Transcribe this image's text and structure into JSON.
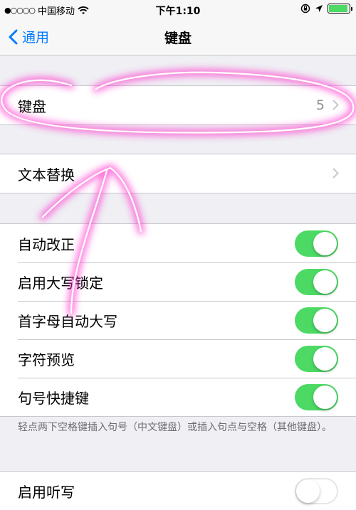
{
  "status_bar": {
    "signal": "●○○○○",
    "carrier": "中国移动",
    "time": "下午1:10"
  },
  "nav": {
    "back_label": "通用",
    "title": "键盘"
  },
  "keyboard_row": {
    "label": "键盘",
    "value": "5"
  },
  "text_replace_row": {
    "label": "文本替换"
  },
  "toggles": [
    {
      "label": "自动改正",
      "on": true
    },
    {
      "label": "启用大写锁定",
      "on": true
    },
    {
      "label": "首字母自动大写",
      "on": true
    },
    {
      "label": "字符预览",
      "on": true
    },
    {
      "label": "句号快捷键",
      "on": true
    }
  ],
  "footer_note": "轻点两下空格键插入句号（中文键盘）或插入句点与空格（其他键盘）。",
  "dictation_row": {
    "label": "启用听写",
    "on": false
  },
  "colors": {
    "accent": "#007aff",
    "toggle_on": "#4cd964",
    "annotation": "#ff33cc"
  }
}
